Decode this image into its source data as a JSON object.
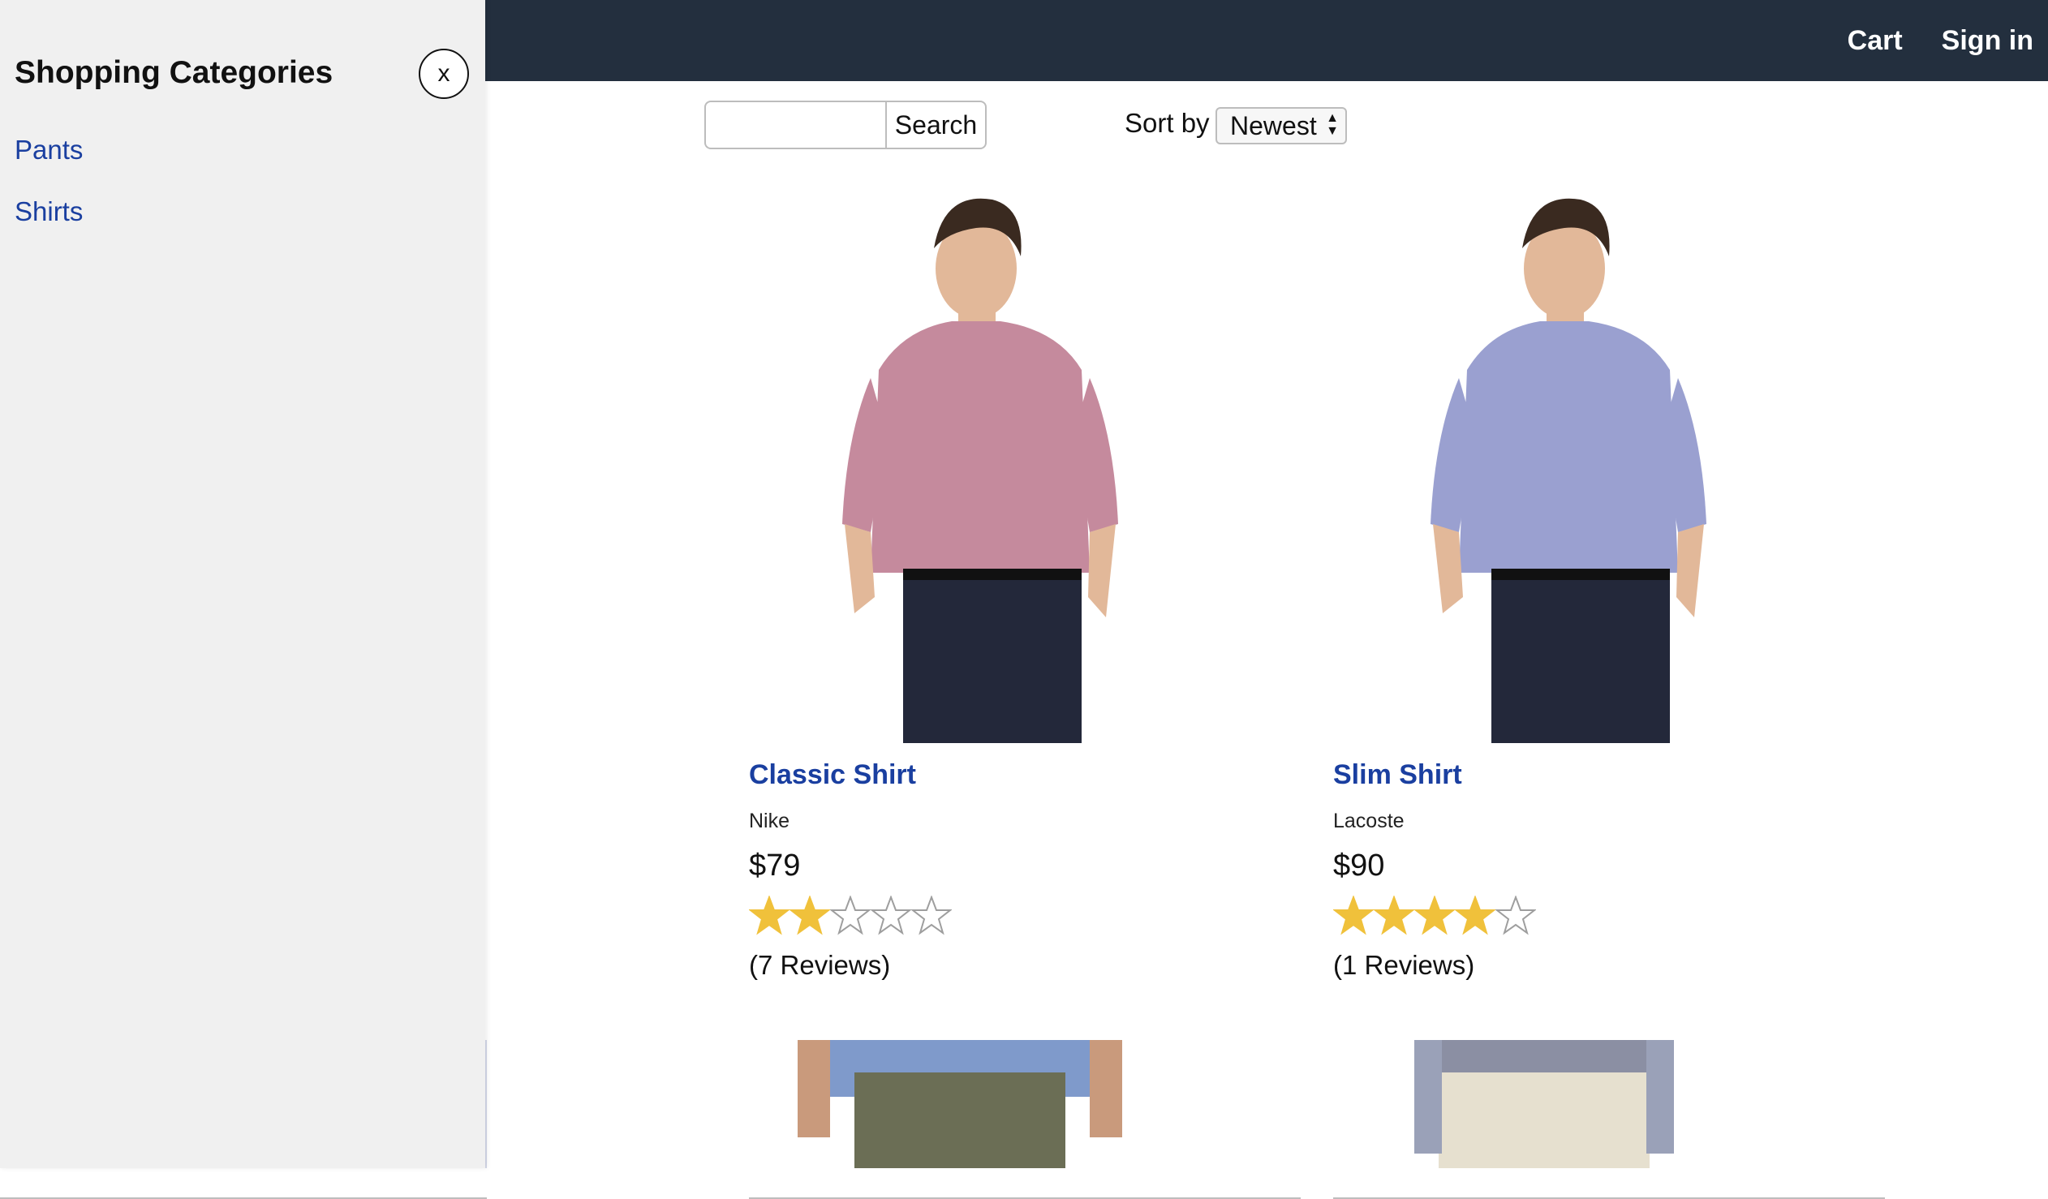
{
  "navbar": {
    "cart_label": "Cart",
    "signin_label": "Sign in"
  },
  "search": {
    "value": "",
    "placeholder": "",
    "button_label": "Search"
  },
  "sort": {
    "label": "Sort by",
    "selected": "Newest"
  },
  "sidebar": {
    "title": "Shopping Categories",
    "close_label": "x",
    "items": [
      {
        "label": "Pants"
      },
      {
        "label": "Shirts"
      }
    ]
  },
  "products": [
    {
      "name": "Classic Shirt",
      "brand": "Nike",
      "price": "$79",
      "rating": 2,
      "rating_max": 5,
      "reviews": "(7 Reviews)",
      "shirt_color": "#c58a9d"
    },
    {
      "name": "Slim Shirt",
      "brand": "Lacoste",
      "price": "$90",
      "rating": 4,
      "rating_max": 5,
      "reviews": "(1 Reviews)",
      "shirt_color": "#9aa0d0"
    }
  ],
  "colors": {
    "navbar": "#232f3e",
    "link": "#1a3fa0",
    "star_filled": "#f0c13b",
    "star_empty": "#9e9e9e",
    "sidebar_bg": "#f0f0f0"
  }
}
